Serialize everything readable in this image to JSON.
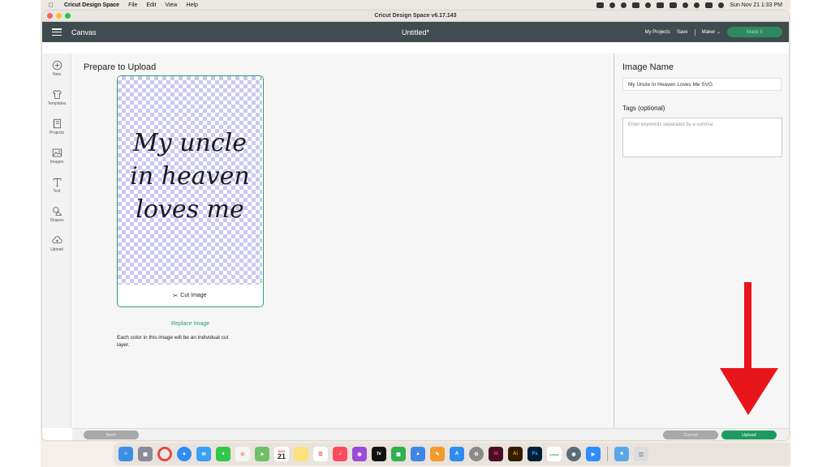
{
  "menubar": {
    "app_name": "Cricut Design Space",
    "items": [
      "File",
      "Edit",
      "View",
      "Help"
    ],
    "clock": "Sun Nov 21  1:33 PM"
  },
  "window": {
    "title": "Cricut Design Space  v6.17.143"
  },
  "header": {
    "canvas_label": "Canvas",
    "doc_title": "Untitled*",
    "my_projects": "My Projects",
    "save": "Save",
    "machine": "Maker",
    "make_button": "Make It"
  },
  "sidebar": {
    "items": [
      {
        "label": "New",
        "icon": "plus-circle-icon"
      },
      {
        "label": "Templates",
        "icon": "shirt-icon"
      },
      {
        "label": "Projects",
        "icon": "notebook-icon"
      },
      {
        "label": "Images",
        "icon": "image-icon"
      },
      {
        "label": "Text",
        "icon": "text-icon"
      },
      {
        "label": "Shapes",
        "icon": "shapes-icon"
      },
      {
        "label": "Upload",
        "icon": "cloud-upload-icon"
      }
    ]
  },
  "main": {
    "heading": "Prepare to Upload",
    "preview_lines": [
      "My uncle",
      "in heaven",
      "loves me"
    ],
    "cut_image_label": "Cut Image",
    "replace_link": "Replace Image",
    "note": "Each color in this image will be an individual cut layer."
  },
  "right_panel": {
    "image_name_label": "Image Name",
    "image_name_value": "My Uncle In Heaven Loves Me SVG",
    "tags_label": "Tags (optional)",
    "tags_placeholder": "Enter keywords separated by a comma"
  },
  "footer": {
    "back": "Back",
    "cancel": "Cancel",
    "upload": "Upload"
  },
  "dock": {
    "calendar_month": "NOV",
    "calendar_day": "21",
    "apps": [
      "Finder",
      "Launchpad",
      "Chrome",
      "Safari",
      "Mail",
      "Messages",
      "Photos",
      "Maps",
      "Calendar",
      "Notes",
      "Reminders",
      "Music",
      "Podcasts",
      "TV",
      "Numbers",
      "Keynote",
      "Pages",
      "App Store",
      "System Preferences",
      "InDesign",
      "Illustrator",
      "Photoshop",
      "Cricut",
      "Camera",
      "Zoom",
      "Folder",
      "Trash"
    ]
  },
  "colors": {
    "app_header": "#404b4f",
    "accent_green": "#1f9a5f",
    "arrow_red": "#e8151b"
  }
}
